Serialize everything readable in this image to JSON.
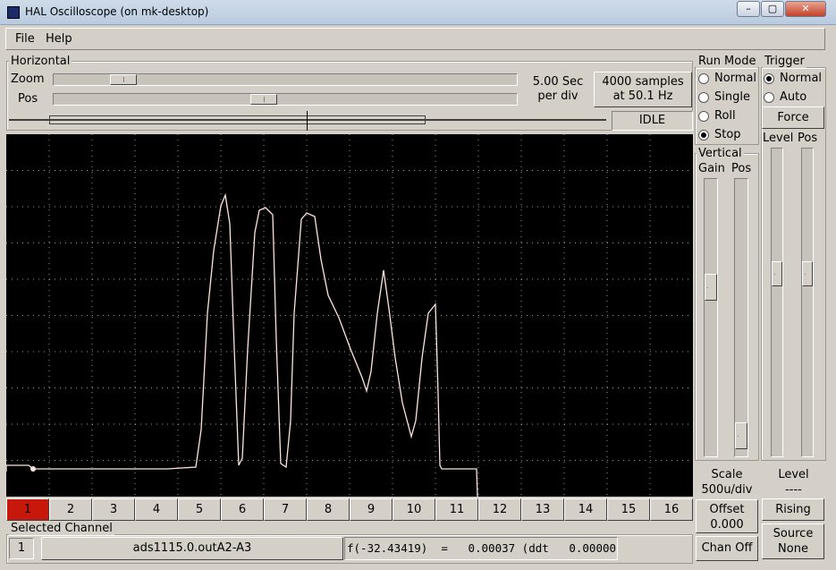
{
  "window": {
    "title": "HAL Oscilloscope (on mk-desktop)",
    "controls": [
      "–",
      "▢",
      "✕"
    ]
  },
  "menu": {
    "file": "File",
    "help": "Help"
  },
  "horizontal": {
    "label": "Horizontal",
    "zoom_label": "Zoom",
    "pos_label": "Pos",
    "zoom_level": 0.13,
    "pos_level": 0.45,
    "time_per_div_line1": "5.00 Sec",
    "time_per_div_line2": "per div",
    "samples_line1": "4000 samples",
    "samples_line2": "at 50.1 Hz",
    "status": "IDLE"
  },
  "run_mode": {
    "label": "Run Mode",
    "options": [
      "Normal",
      "Single",
      "Roll",
      "Stop"
    ],
    "selected": "Stop"
  },
  "trigger": {
    "label": "Trigger",
    "options": [
      "Normal",
      "Auto"
    ],
    "selected": "Normal",
    "force": "Force",
    "level_label": "Level",
    "pos_label": "Pos",
    "level_readout_label": "Level",
    "level_readout_value": "----",
    "edge": "Rising",
    "source_label": "Source",
    "source_value": "None",
    "level_value": 0.6,
    "pos_value": 0.6
  },
  "vertical": {
    "label": "Vertical",
    "gain_label": "Gain",
    "pos_label": "Pos",
    "gain_value": 0.62,
    "pos_value": 0.03,
    "scale_label": "Scale",
    "scale_value": "500u/div",
    "offset_label": "Offset",
    "offset_value": "0.000",
    "chan_off": "Chan Off"
  },
  "channels": [
    "1",
    "2",
    "3",
    "4",
    "5",
    "6",
    "7",
    "8",
    "9",
    "10",
    "11",
    "12",
    "13",
    "14",
    "15",
    "16"
  ],
  "selected_channel": {
    "label": "Selected Channel",
    "number": "1",
    "name": "ads1115.0.outA2-A3",
    "readout": "f(-32.43419)  =   0.00037 (ddt   0.00000)"
  },
  "colors": {
    "trace": "#ffe4dc",
    "selected_channel": "#c8170b",
    "grid": "#9a9a9a",
    "screen": "#000000"
  }
}
